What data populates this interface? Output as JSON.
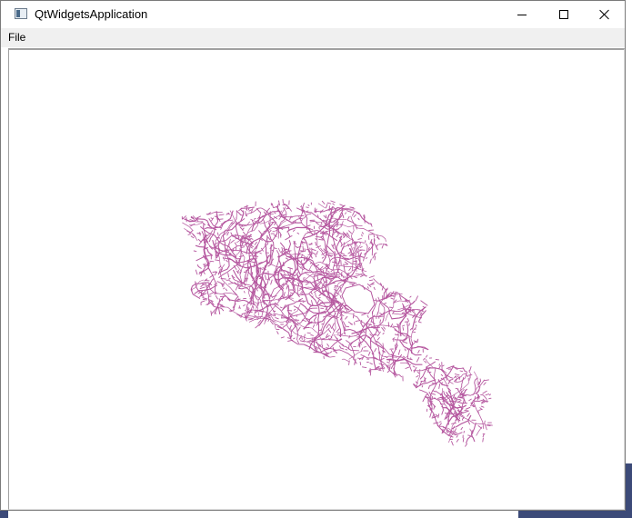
{
  "window": {
    "title": "QtWidgetsApplication",
    "controls": {
      "minimize_icon": "minimize-icon",
      "maximize_icon": "maximize-icon",
      "close_icon": "close-icon"
    }
  },
  "menubar": {
    "items": [
      {
        "label": "File"
      }
    ]
  },
  "map_view": {
    "road_color": "#b5579f",
    "background_color": "#ffffff"
  }
}
